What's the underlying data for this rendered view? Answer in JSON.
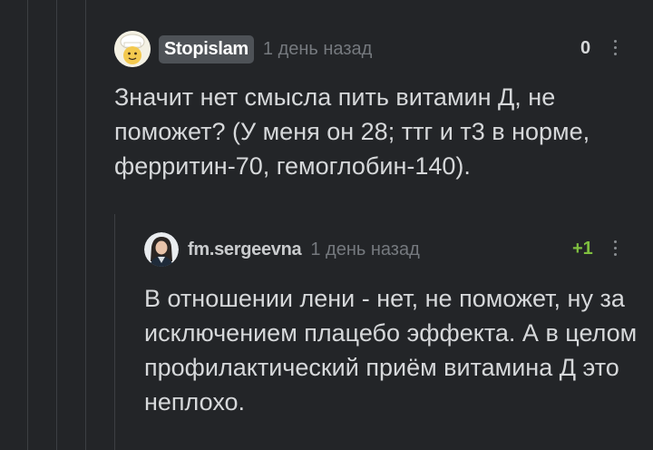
{
  "comments": [
    {
      "username": "Stopislam",
      "time": "1 день назад",
      "rating": "0",
      "avatar_icon": "cartoon-chef-avatar",
      "text": "Значит нет смысла пить витамин Д, не поможет? (У меня он 28; ттг и т3 в норме, ферритин-70, гемоглобин-140)."
    },
    {
      "username": "fm.sergeevna",
      "time": "1 день назад",
      "rating": "+1",
      "avatar_icon": "user-photo-avatar",
      "text": "В отношении лени - нет, не поможет, ну за исключением плацебо эффекта. А в целом профилактический приём витамина Д это неплохо."
    }
  ],
  "colors": {
    "background": "#232528",
    "thread_line": "#3c3f43",
    "rating_positive": "#7fbf3f",
    "rating_neutral": "#d6d8da"
  }
}
